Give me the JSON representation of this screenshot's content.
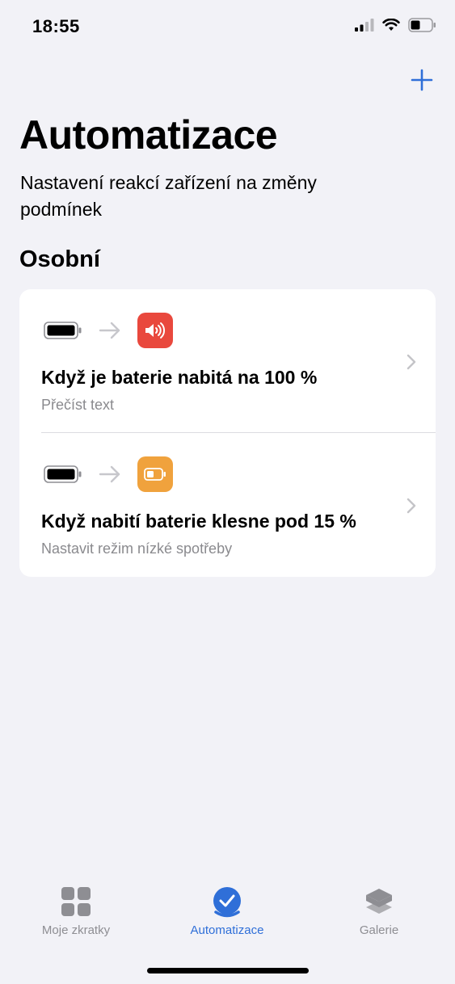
{
  "status_bar": {
    "time": "18:55"
  },
  "header": {
    "title": "Automatizace",
    "subtitle": "Nastavení reakcí zařízení na změny podmínek"
  },
  "section": {
    "title": "Osobní"
  },
  "automations": [
    {
      "title": "Když je baterie nabitá na 100 %",
      "subtitle": "Přečíst text",
      "trigger_icon": "battery-full-icon",
      "action_icon": "speaker-icon",
      "action_color": "#e9483d"
    },
    {
      "title": "Když nabití baterie klesne pod 15 %",
      "subtitle": "Nastavit režim nízké spotřeby",
      "trigger_icon": "battery-full-icon",
      "action_icon": "low-battery-icon",
      "action_color": "#f0a23d"
    }
  ],
  "tabbar": {
    "tabs": [
      {
        "label": "Moje zkratky",
        "icon": "grid-icon",
        "active": false
      },
      {
        "label": "Automatizace",
        "icon": "checkmark-circle-icon",
        "active": true
      },
      {
        "label": "Galerie",
        "icon": "layers-icon",
        "active": false
      }
    ]
  },
  "colors": {
    "accent": "#2f6fd8",
    "background": "#f2f2f7"
  }
}
